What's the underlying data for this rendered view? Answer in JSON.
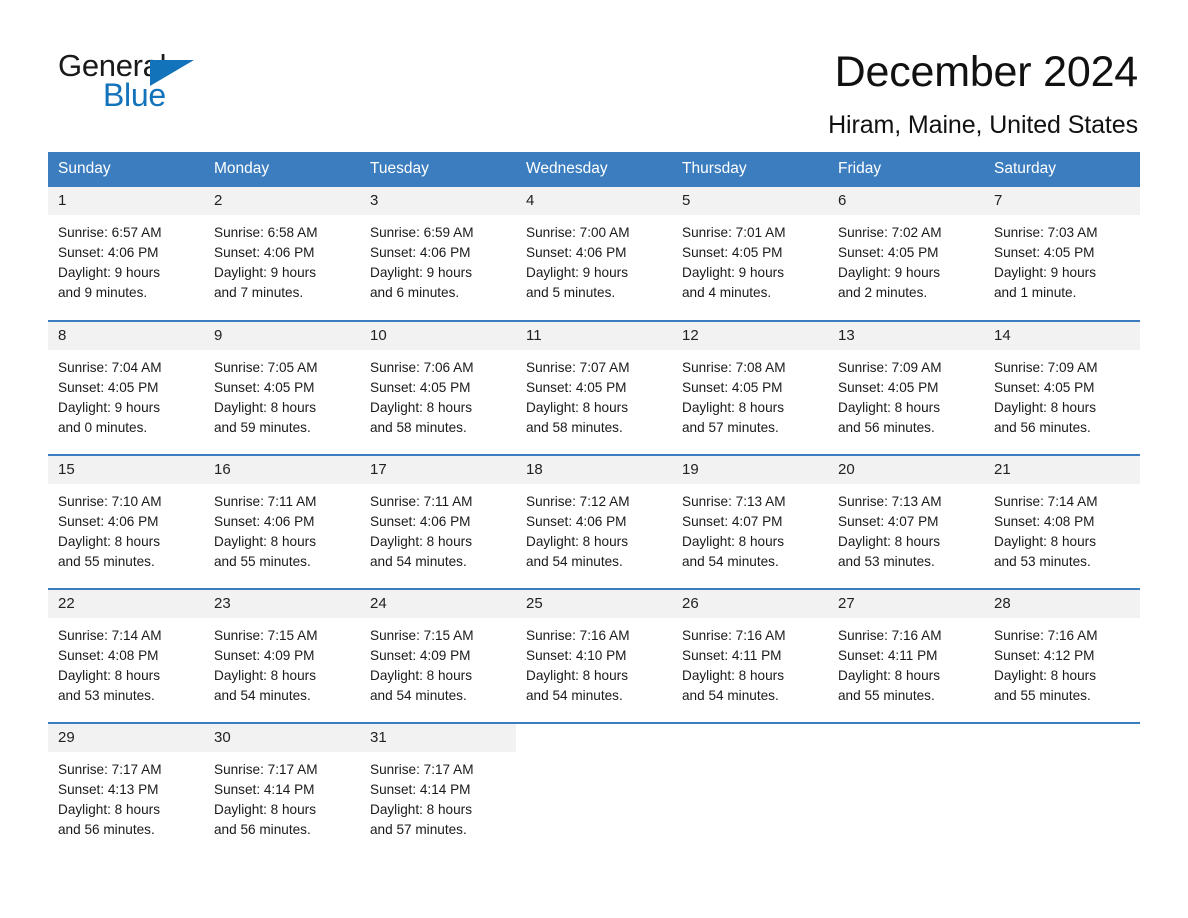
{
  "brand": {
    "name_dark": "General",
    "name_light": "Blue",
    "triangle_color": "#1272ba",
    "blue_color": "#1272ba"
  },
  "header": {
    "title": "December 2024",
    "subtitle": "Hiram, Maine, United States",
    "header_bg": "#3b7dbf",
    "daynum_bg": "#f2f2f2"
  },
  "calendar": {
    "weekdays": [
      "Sunday",
      "Monday",
      "Tuesday",
      "Wednesday",
      "Thursday",
      "Friday",
      "Saturday"
    ],
    "weeks": [
      [
        {
          "day": "1",
          "sunrise": "Sunrise: 6:57 AM",
          "sunset": "Sunset: 4:06 PM",
          "daylight1": "Daylight: 9 hours",
          "daylight2": "and 9 minutes."
        },
        {
          "day": "2",
          "sunrise": "Sunrise: 6:58 AM",
          "sunset": "Sunset: 4:06 PM",
          "daylight1": "Daylight: 9 hours",
          "daylight2": "and 7 minutes."
        },
        {
          "day": "3",
          "sunrise": "Sunrise: 6:59 AM",
          "sunset": "Sunset: 4:06 PM",
          "daylight1": "Daylight: 9 hours",
          "daylight2": "and 6 minutes."
        },
        {
          "day": "4",
          "sunrise": "Sunrise: 7:00 AM",
          "sunset": "Sunset: 4:06 PM",
          "daylight1": "Daylight: 9 hours",
          "daylight2": "and 5 minutes."
        },
        {
          "day": "5",
          "sunrise": "Sunrise: 7:01 AM",
          "sunset": "Sunset: 4:05 PM",
          "daylight1": "Daylight: 9 hours",
          "daylight2": "and 4 minutes."
        },
        {
          "day": "6",
          "sunrise": "Sunrise: 7:02 AM",
          "sunset": "Sunset: 4:05 PM",
          "daylight1": "Daylight: 9 hours",
          "daylight2": "and 2 minutes."
        },
        {
          "day": "7",
          "sunrise": "Sunrise: 7:03 AM",
          "sunset": "Sunset: 4:05 PM",
          "daylight1": "Daylight: 9 hours",
          "daylight2": "and 1 minute."
        }
      ],
      [
        {
          "day": "8",
          "sunrise": "Sunrise: 7:04 AM",
          "sunset": "Sunset: 4:05 PM",
          "daylight1": "Daylight: 9 hours",
          "daylight2": "and 0 minutes."
        },
        {
          "day": "9",
          "sunrise": "Sunrise: 7:05 AM",
          "sunset": "Sunset: 4:05 PM",
          "daylight1": "Daylight: 8 hours",
          "daylight2": "and 59 minutes."
        },
        {
          "day": "10",
          "sunrise": "Sunrise: 7:06 AM",
          "sunset": "Sunset: 4:05 PM",
          "daylight1": "Daylight: 8 hours",
          "daylight2": "and 58 minutes."
        },
        {
          "day": "11",
          "sunrise": "Sunrise: 7:07 AM",
          "sunset": "Sunset: 4:05 PM",
          "daylight1": "Daylight: 8 hours",
          "daylight2": "and 58 minutes."
        },
        {
          "day": "12",
          "sunrise": "Sunrise: 7:08 AM",
          "sunset": "Sunset: 4:05 PM",
          "daylight1": "Daylight: 8 hours",
          "daylight2": "and 57 minutes."
        },
        {
          "day": "13",
          "sunrise": "Sunrise: 7:09 AM",
          "sunset": "Sunset: 4:05 PM",
          "daylight1": "Daylight: 8 hours",
          "daylight2": "and 56 minutes."
        },
        {
          "day": "14",
          "sunrise": "Sunrise: 7:09 AM",
          "sunset": "Sunset: 4:05 PM",
          "daylight1": "Daylight: 8 hours",
          "daylight2": "and 56 minutes."
        }
      ],
      [
        {
          "day": "15",
          "sunrise": "Sunrise: 7:10 AM",
          "sunset": "Sunset: 4:06 PM",
          "daylight1": "Daylight: 8 hours",
          "daylight2": "and 55 minutes."
        },
        {
          "day": "16",
          "sunrise": "Sunrise: 7:11 AM",
          "sunset": "Sunset: 4:06 PM",
          "daylight1": "Daylight: 8 hours",
          "daylight2": "and 55 minutes."
        },
        {
          "day": "17",
          "sunrise": "Sunrise: 7:11 AM",
          "sunset": "Sunset: 4:06 PM",
          "daylight1": "Daylight: 8 hours",
          "daylight2": "and 54 minutes."
        },
        {
          "day": "18",
          "sunrise": "Sunrise: 7:12 AM",
          "sunset": "Sunset: 4:06 PM",
          "daylight1": "Daylight: 8 hours",
          "daylight2": "and 54 minutes."
        },
        {
          "day": "19",
          "sunrise": "Sunrise: 7:13 AM",
          "sunset": "Sunset: 4:07 PM",
          "daylight1": "Daylight: 8 hours",
          "daylight2": "and 54 minutes."
        },
        {
          "day": "20",
          "sunrise": "Sunrise: 7:13 AM",
          "sunset": "Sunset: 4:07 PM",
          "daylight1": "Daylight: 8 hours",
          "daylight2": "and 53 minutes."
        },
        {
          "day": "21",
          "sunrise": "Sunrise: 7:14 AM",
          "sunset": "Sunset: 4:08 PM",
          "daylight1": "Daylight: 8 hours",
          "daylight2": "and 53 minutes."
        }
      ],
      [
        {
          "day": "22",
          "sunrise": "Sunrise: 7:14 AM",
          "sunset": "Sunset: 4:08 PM",
          "daylight1": "Daylight: 8 hours",
          "daylight2": "and 53 minutes."
        },
        {
          "day": "23",
          "sunrise": "Sunrise: 7:15 AM",
          "sunset": "Sunset: 4:09 PM",
          "daylight1": "Daylight: 8 hours",
          "daylight2": "and 54 minutes."
        },
        {
          "day": "24",
          "sunrise": "Sunrise: 7:15 AM",
          "sunset": "Sunset: 4:09 PM",
          "daylight1": "Daylight: 8 hours",
          "daylight2": "and 54 minutes."
        },
        {
          "day": "25",
          "sunrise": "Sunrise: 7:16 AM",
          "sunset": "Sunset: 4:10 PM",
          "daylight1": "Daylight: 8 hours",
          "daylight2": "and 54 minutes."
        },
        {
          "day": "26",
          "sunrise": "Sunrise: 7:16 AM",
          "sunset": "Sunset: 4:11 PM",
          "daylight1": "Daylight: 8 hours",
          "daylight2": "and 54 minutes."
        },
        {
          "day": "27",
          "sunrise": "Sunrise: 7:16 AM",
          "sunset": "Sunset: 4:11 PM",
          "daylight1": "Daylight: 8 hours",
          "daylight2": "and 55 minutes."
        },
        {
          "day": "28",
          "sunrise": "Sunrise: 7:16 AM",
          "sunset": "Sunset: 4:12 PM",
          "daylight1": "Daylight: 8 hours",
          "daylight2": "and 55 minutes."
        }
      ],
      [
        {
          "day": "29",
          "sunrise": "Sunrise: 7:17 AM",
          "sunset": "Sunset: 4:13 PM",
          "daylight1": "Daylight: 8 hours",
          "daylight2": "and 56 minutes."
        },
        {
          "day": "30",
          "sunrise": "Sunrise: 7:17 AM",
          "sunset": "Sunset: 4:14 PM",
          "daylight1": "Daylight: 8 hours",
          "daylight2": "and 56 minutes."
        },
        {
          "day": "31",
          "sunrise": "Sunrise: 7:17 AM",
          "sunset": "Sunset: 4:14 PM",
          "daylight1": "Daylight: 8 hours",
          "daylight2": "and 57 minutes."
        },
        {
          "day": "",
          "sunrise": "",
          "sunset": "",
          "daylight1": "",
          "daylight2": ""
        },
        {
          "day": "",
          "sunrise": "",
          "sunset": "",
          "daylight1": "",
          "daylight2": ""
        },
        {
          "day": "",
          "sunrise": "",
          "sunset": "",
          "daylight1": "",
          "daylight2": ""
        },
        {
          "day": "",
          "sunrise": "",
          "sunset": "",
          "daylight1": "",
          "daylight2": ""
        }
      ]
    ]
  }
}
